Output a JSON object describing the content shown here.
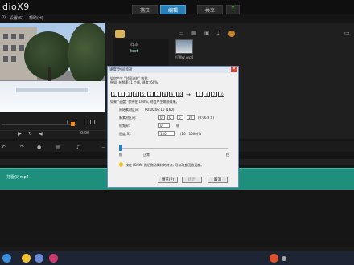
{
  "app": {
    "title": "dioX9",
    "menu": [
      "0)",
      "设置(S)",
      "帮助(H)"
    ]
  },
  "tabs": [
    {
      "label": "捕获"
    },
    {
      "label": "编辑"
    },
    {
      "label": "共享"
    }
  ],
  "preview": {
    "controls": [
      "[",
      "]"
    ],
    "timecode": "0:00"
  },
  "library": {
    "nodes": [
      "样本",
      "test"
    ],
    "media": [
      {
        "name": "打雷仪.mp4"
      }
    ]
  },
  "timeline": {
    "clip_name": "打雷仪.mp4"
  },
  "dialog": {
    "title": "速度/时间流逝",
    "line1": "如何产生 \"时间流逝\" 效果:",
    "line2": "例如: 帧频率: 1 个帧, 速度: 60%",
    "filmstrip_left": [
      "1",
      "2",
      "3",
      "4",
      "5",
      "6",
      "7",
      "8",
      "9",
      "10"
    ],
    "filmstrip_right": [
      "1",
      "4",
      "7",
      "10"
    ],
    "note": "如果 \"速度\" 保持在 100%, 则会产生跳帧效果。",
    "original_label": "原始素材区间:",
    "original_value": "00:00:06:10 (160)",
    "new_label": "新素材区间:",
    "new_values": [
      "0",
      "0",
      "6",
      "10"
    ],
    "new_unit": "(0:06:2:0)",
    "frame_label": "帧频率:",
    "frame_value": "0",
    "frame_unit": "帧",
    "speed_label": "速度(S):",
    "speed_value": "100",
    "speed_range": "(10 - 1000)%",
    "slider_labels": [
      "慢",
      "正常",
      "快"
    ],
    "tip": "按住 [Shift] 然后拖动素材的终点, 可以改变回放速度。",
    "buttons": [
      "预览(P)",
      "确定",
      "取消"
    ]
  },
  "colors": {
    "accent": "#2a7fb6",
    "clip": "#1f8f7d",
    "scrub": "#ff8a00"
  }
}
